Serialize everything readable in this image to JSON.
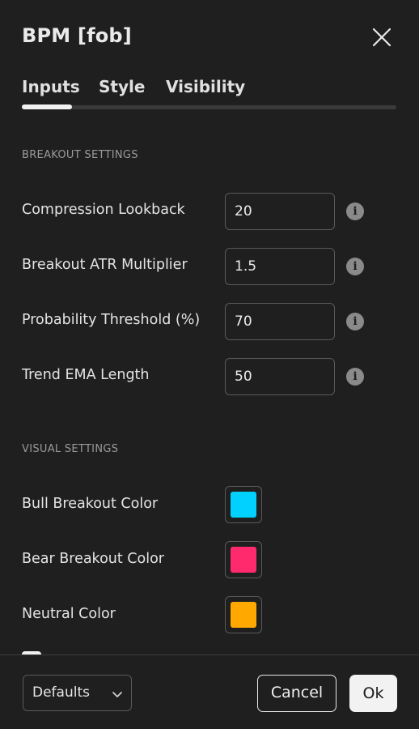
{
  "dialog": {
    "title": "BPM [fob]"
  },
  "tabs": [
    {
      "label": "Inputs",
      "active": true
    },
    {
      "label": "Style",
      "active": false
    },
    {
      "label": "Visibility",
      "active": false
    }
  ],
  "breakout_settings": {
    "title": "BREAKOUT SETTINGS",
    "rows": [
      {
        "label": "Compression Lookback",
        "value": "20"
      },
      {
        "label": "Breakout ATR Multiplier",
        "value": "1.5"
      },
      {
        "label": "Probability Threshold (%)",
        "value": "70"
      },
      {
        "label": "Trend EMA Length",
        "value": "50"
      }
    ]
  },
  "visual_settings": {
    "title": "VISUAL SETTINGS",
    "rows": [
      {
        "label": "Bull Breakout Color",
        "color": "#00d1ff"
      },
      {
        "label": "Bear Breakout Color",
        "color": "#ff2a6d"
      },
      {
        "label": "Neutral Color",
        "color": "#ffa800"
      }
    ]
  },
  "footer": {
    "defaults_label": "Defaults",
    "cancel_label": "Cancel",
    "ok_label": "Ok"
  },
  "icons": {
    "close": "close-icon",
    "info": "info-icon",
    "chevron": "chevron-down-icon"
  }
}
